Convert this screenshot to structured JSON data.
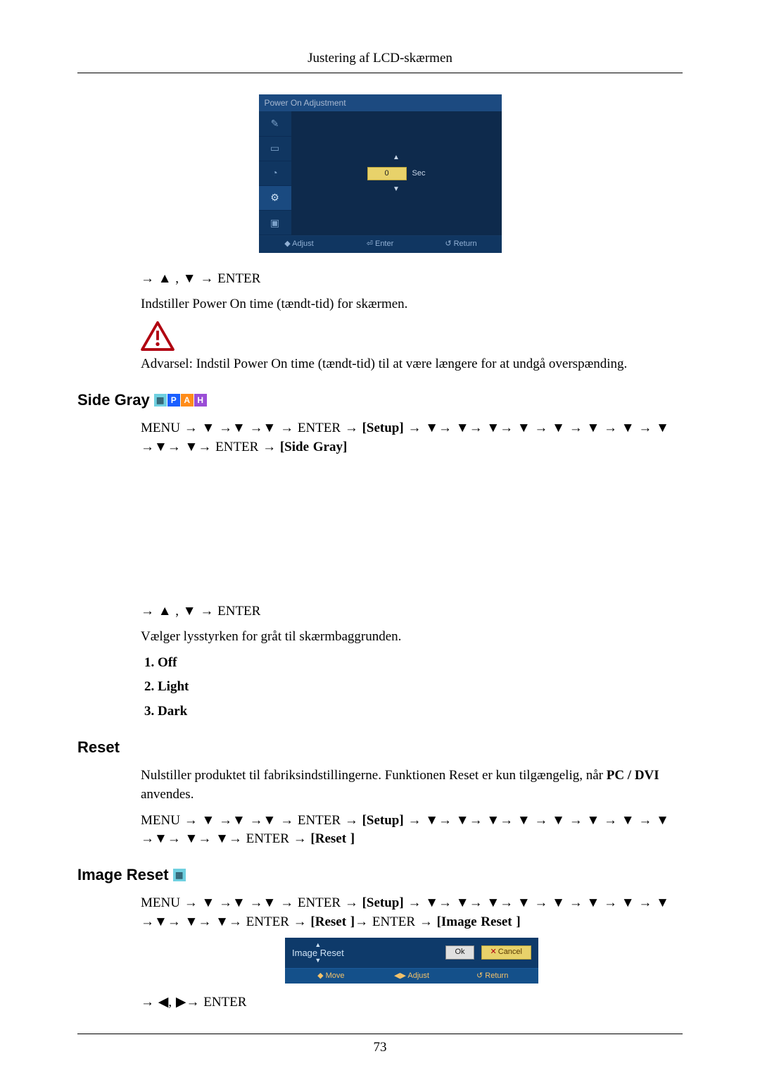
{
  "header": {
    "title": "Justering af LCD-skærmen"
  },
  "page_number": "73",
  "osd1": {
    "title": "Power On Adjustment",
    "value": "0",
    "unit": "Sec",
    "footer": {
      "adjust": "◆ Adjust",
      "enter": "⏎ Enter",
      "return": "↺ Return"
    }
  },
  "power_on": {
    "seq": "→ ▲ , ▼ → ENTER",
    "text": "Indstiller Power On time (tændt-tid) for skærmen.",
    "warning": "Advarsel: Indstil Power On time (tændt-tid) til at være længere for at undgå overspænding."
  },
  "side_gray": {
    "heading": "Side Gray",
    "menu_seq": "MENU → ▼ →▼ →▼ → ENTER → [Setup] → ▼→ ▼→ ▼→ ▼ → ▼ → ▼ → ▼ → ▼ →▼→ ▼→ ENTER → [Side Gray]",
    "seq2": "→ ▲ , ▼ → ENTER",
    "desc": "Vælger lysstyrken for gråt til skærmbaggrunden.",
    "options": {
      "o1": "Off",
      "o2": "Light",
      "o3": "Dark"
    }
  },
  "reset": {
    "heading": "Reset",
    "desc": "Nulstiller produktet til fabriksindstillingerne. Funktionen Reset er kun tilgængelig, når PC / DVI anvendes.",
    "menu_seq": "MENU → ▼ →▼ →▼ → ENTER → [Setup] → ▼→ ▼→ ▼→ ▼ → ▼ → ▼ → ▼ → ▼ →▼→ ▼→ ▼→ ENTER → [Reset ]"
  },
  "image_reset": {
    "heading": "Image Reset",
    "menu_seq": "MENU → ▼ →▼ →▼ → ENTER → [Setup] → ▼→ ▼→ ▼→ ▼ → ▼ → ▼ → ▼ → ▼ →▼→ ▼→ ▼→ ENTER → [Reset ]→ ENTER → [Image Reset ]",
    "osd": {
      "title": "Image Reset",
      "ok": "Ok",
      "cancel": "Cancel",
      "footer": {
        "move": "◆ Move",
        "adjust": "◀▶ Adjust",
        "return": "↺ Return"
      }
    },
    "seq2": "→ ◀, ▶→ ENTER"
  }
}
